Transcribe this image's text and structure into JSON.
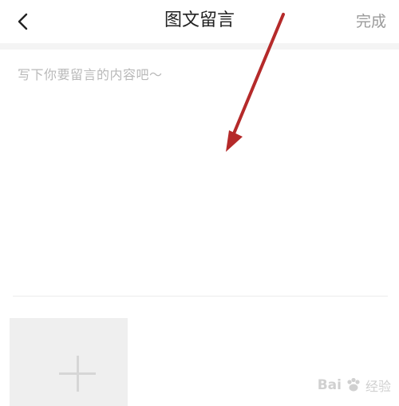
{
  "header": {
    "title": "图文留言",
    "done_label": "完成",
    "back_icon": "chevron-left-icon"
  },
  "compose": {
    "placeholder": "写下你要留言的内容吧～"
  },
  "attachment": {
    "add_icon": "plus-icon"
  },
  "annotation": {
    "arrow_color": "#b52a2a"
  },
  "watermark": {
    "brand": "Bai",
    "sub": "经验"
  },
  "colors": {
    "title": "#222222",
    "done": "#9a9a9a",
    "placeholder": "#b9b9b9",
    "band": "#f4f4f4",
    "tile": "#efefef"
  }
}
